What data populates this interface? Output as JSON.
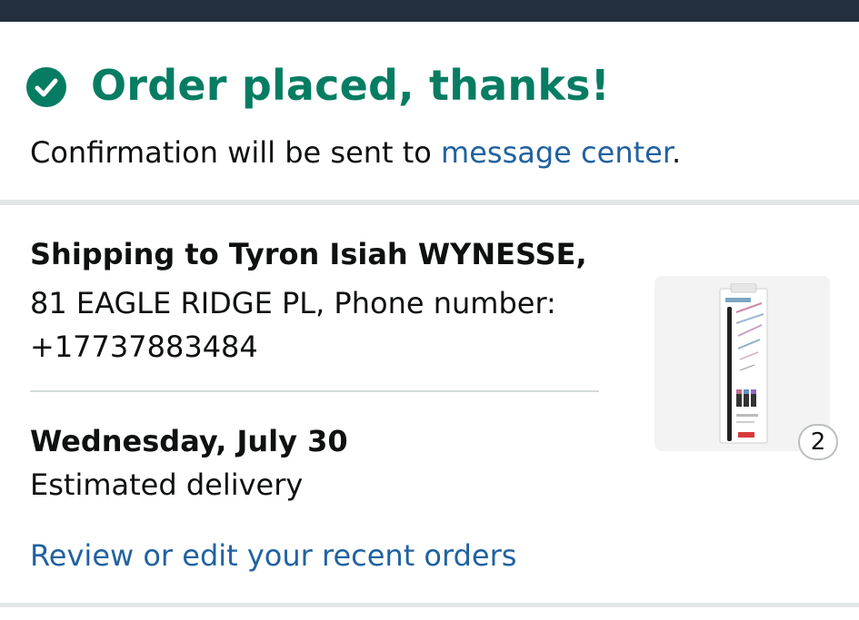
{
  "confirmation": {
    "title": "Order placed, thanks!",
    "message_prefix": "Confirmation will be sent to ",
    "message_link": "message center",
    "message_suffix": "."
  },
  "shipping": {
    "heading": "Shipping to Tyron Isiah WYNESSE,",
    "address_line1": "81 EAGLE RIDGE PL, Phone number:",
    "address_line2": "+17737883484"
  },
  "delivery": {
    "date": "Wednesday, July 30",
    "label": "Estimated delivery"
  },
  "orders_link": "Review or edit your recent orders",
  "product": {
    "quantity": "2",
    "image_icon": "brush-pen-set-package"
  },
  "colors": {
    "success_green": "#067d62",
    "link_blue": "#2162a1",
    "top_bar": "#232f3e"
  }
}
